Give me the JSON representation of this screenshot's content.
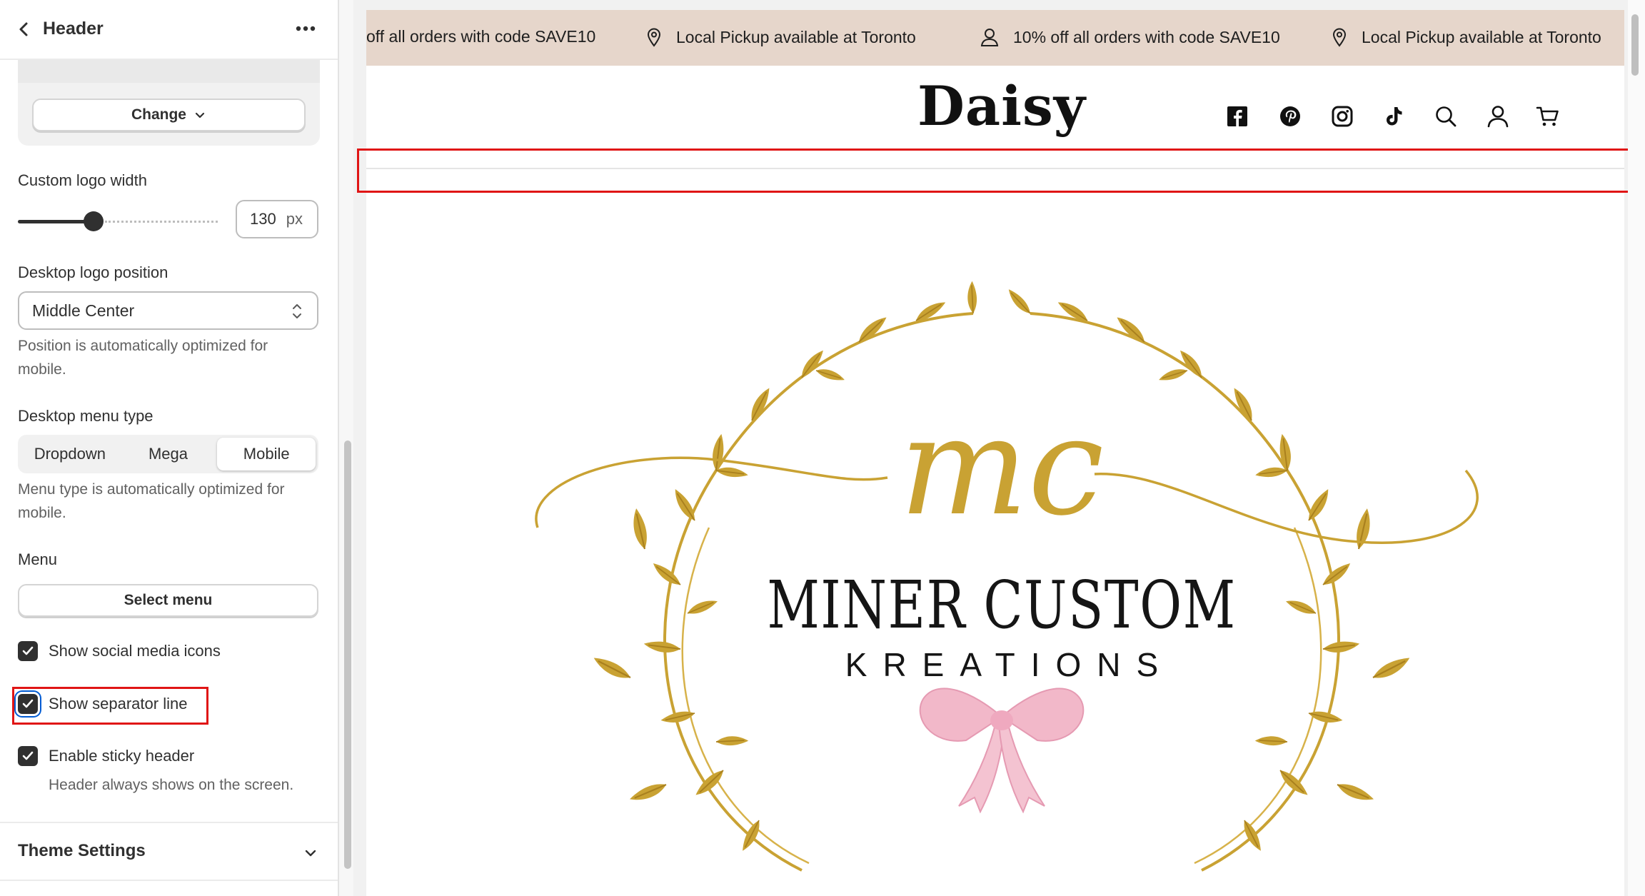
{
  "sidebar": {
    "title": "Header",
    "change_label": "Change",
    "logo_width": {
      "label": "Custom logo width",
      "value": "130",
      "unit": "px",
      "slider_fraction": 0.2
    },
    "logo_position": {
      "label": "Desktop logo position",
      "value": "Middle Center",
      "help": "Position is automatically optimized for mobile."
    },
    "menu_type": {
      "label": "Desktop menu type",
      "options": [
        "Dropdown",
        "Mega",
        "Mobile"
      ],
      "selected": "Mobile",
      "help": "Menu type is automatically optimized for mobile."
    },
    "menu": {
      "label": "Menu",
      "button": "Select menu"
    },
    "checkboxes": {
      "social": {
        "label": "Show social media icons",
        "checked": true
      },
      "separator": {
        "label": "Show separator line",
        "checked": true
      },
      "sticky": {
        "label": "Enable sticky header",
        "checked": true,
        "help": "Header always shows on the screen."
      }
    },
    "theme_settings": "Theme Settings"
  },
  "preview": {
    "announcements": [
      "off all orders with code SAVE10",
      "Local Pickup available at Toronto",
      "10% off all orders with code SAVE10",
      "Local Pickup available at Toronto"
    ],
    "logo_text": "Daisy",
    "header_icons": [
      "facebook-icon",
      "pinterest-icon",
      "instagram-icon",
      "tiktok-icon",
      "search-icon",
      "account-icon",
      "cart-icon"
    ],
    "hero": {
      "monogram": "mc",
      "brand_main": "MINER CUSTOM",
      "brand_sub": "KREATIONS"
    },
    "colors": {
      "announcement_bg": "#e6d6cb",
      "highlight": "#e01515",
      "gold": "#c9a233",
      "bow": "#f2b8c9"
    }
  }
}
